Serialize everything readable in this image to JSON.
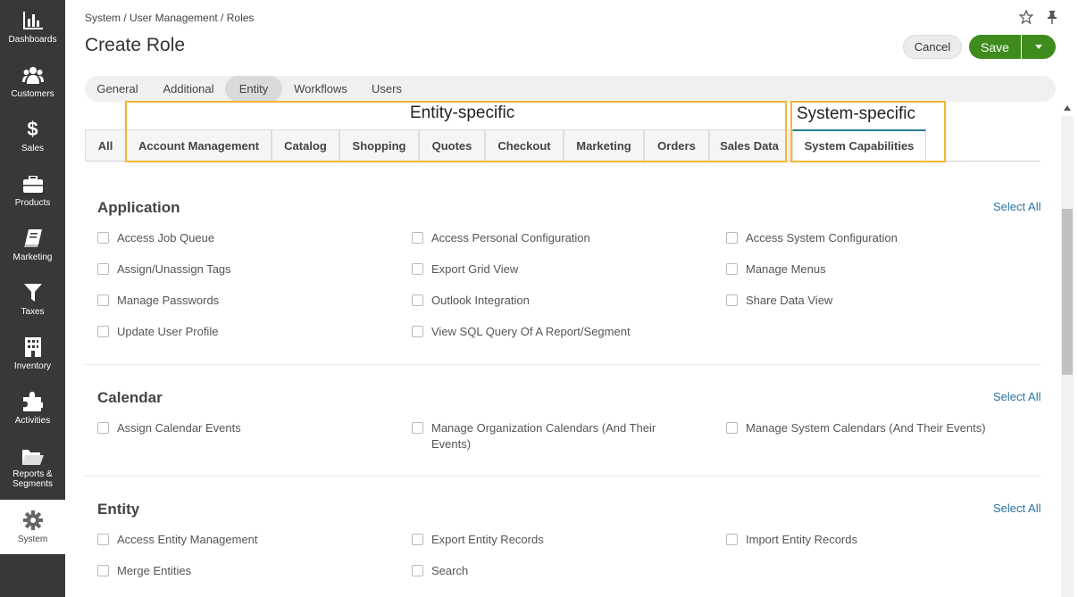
{
  "sidebar": {
    "items": [
      {
        "label": "Dashboards",
        "icon": "bar-chart-icon"
      },
      {
        "label": "Customers",
        "icon": "users-icon"
      },
      {
        "label": "Sales",
        "icon": "dollar-icon"
      },
      {
        "label": "Products",
        "icon": "briefcase-icon"
      },
      {
        "label": "Marketing",
        "icon": "book-icon"
      },
      {
        "label": "Taxes",
        "icon": "filter-icon"
      },
      {
        "label": "Inventory",
        "icon": "building-icon"
      },
      {
        "label": "Activities",
        "icon": "puzzle-icon"
      },
      {
        "label": "Reports &",
        "label2": "Segments",
        "icon": "folder-icon"
      },
      {
        "label": "System",
        "icon": "gear-icon"
      }
    ]
  },
  "header": {
    "breadcrumb": "System / User Management / Roles",
    "title": "Create Role",
    "cancel_label": "Cancel",
    "save_label": "Save"
  },
  "main_tabs": [
    "General",
    "Additional",
    "Entity",
    "Workflows",
    "Users"
  ],
  "annotations": {
    "entity": "Entity-specific",
    "system": "System-specific"
  },
  "sub_tabs": [
    "All",
    "Account Management",
    "Catalog",
    "Shopping",
    "Quotes",
    "Checkout",
    "Marketing",
    "Orders",
    "Sales Data",
    "System Capabilities"
  ],
  "select_all": "Select All",
  "sections": {
    "application": {
      "title": "Application",
      "items": [
        "Access Job Queue",
        "Access Personal Configuration",
        "Access System Configuration",
        "Assign/Unassign Tags",
        "Export Grid View",
        "Manage Menus",
        "Manage Passwords",
        "Outlook Integration",
        "Share Data View",
        "Update User Profile",
        "View SQL Query Of A Report/Segment"
      ]
    },
    "calendar": {
      "title": "Calendar",
      "items": [
        "Assign Calendar Events",
        "Manage Organization Calendars (And Their",
        "Events)",
        "Manage System Calendars (And Their Events)"
      ]
    },
    "entity": {
      "title": "Entity",
      "items": [
        "Access Entity Management",
        "Export Entity Records",
        "Import Entity Records",
        "Merge Entities",
        "Search"
      ]
    }
  }
}
